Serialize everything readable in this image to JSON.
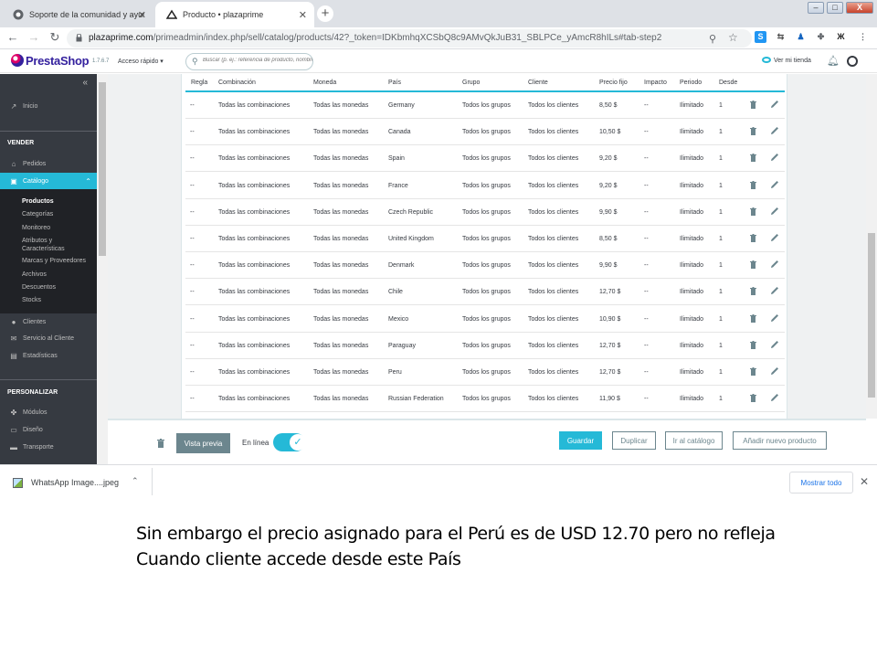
{
  "browser": {
    "tabs": [
      {
        "title": "Soporte de la comunidad y ayuda"
      },
      {
        "title": "Producto • plazaprime"
      }
    ],
    "new_tab": "+",
    "url_host": "plazaprime.com",
    "url_path": "/primeadmin/index.php/sell/catalog/products/42?_token=IDKbmhqXCSbQ8c9AMvQkJuB31_SBLPCe_yAmcR8hILs#tab-step2",
    "window_controls": [
      "–",
      "□",
      "X"
    ]
  },
  "ps_header": {
    "logo": "PrestaShop",
    "version": "1.7.6.7",
    "quick_access": "Acceso rápido ▾",
    "search_placeholder": "Buscar (p. ej.: referencia de producto, nombre de cliente…)",
    "view_store": "Ver mi tienda"
  },
  "sidebar": {
    "collapse": "«",
    "inicio": "Inicio",
    "vender_section": "VENDER",
    "pedidos": "Pedidos",
    "catalogo": "Catálogo",
    "submenu": [
      "Productos",
      "Categorías",
      "Monitoreo",
      "Atributos y Características",
      "Marcas y Proveedores",
      "Archivos",
      "Descuentos",
      "Stocks"
    ],
    "clientes": "Clientes",
    "servicio": "Servicio al Cliente",
    "estadisticas": "Estadísticas",
    "personalizar_section": "PERSONALIZAR",
    "modulos": "Módulos",
    "diseno": "Diseño",
    "transporte": "Transporte"
  },
  "price_table": {
    "headers": [
      "Regla",
      "Combinación",
      "Moneda",
      "País",
      "Grupo",
      "Cliente",
      "Precio fijo",
      "Impacto",
      "Periodo",
      "Desde"
    ],
    "rows": [
      {
        "regla": "--",
        "combinacion": "Todas las combinaciones",
        "moneda": "Todas las monedas",
        "pais": "Germany",
        "grupo": "Todos los grupos",
        "cliente": "Todos los clientes",
        "precio": "8,50 $",
        "impacto": "--",
        "periodo": "Ilimitado",
        "desde": "1"
      },
      {
        "regla": "--",
        "combinacion": "Todas las combinaciones",
        "moneda": "Todas las monedas",
        "pais": "Canada",
        "grupo": "Todos los grupos",
        "cliente": "Todos los clientes",
        "precio": "10,50 $",
        "impacto": "--",
        "periodo": "Ilimitado",
        "desde": "1"
      },
      {
        "regla": "--",
        "combinacion": "Todas las combinaciones",
        "moneda": "Todas las monedas",
        "pais": "Spain",
        "grupo": "Todos los grupos",
        "cliente": "Todos los clientes",
        "precio": "9,20 $",
        "impacto": "--",
        "periodo": "Ilimitado",
        "desde": "1"
      },
      {
        "regla": "--",
        "combinacion": "Todas las combinaciones",
        "moneda": "Todas las monedas",
        "pais": "France",
        "grupo": "Todos los grupos",
        "cliente": "Todos los clientes",
        "precio": "9,20 $",
        "impacto": "--",
        "periodo": "Ilimitado",
        "desde": "1"
      },
      {
        "regla": "--",
        "combinacion": "Todas las combinaciones",
        "moneda": "Todas las monedas",
        "pais": "Czech Republic",
        "grupo": "Todos los grupos",
        "cliente": "Todos los clientes",
        "precio": "9,90 $",
        "impacto": "--",
        "periodo": "Ilimitado",
        "desde": "1"
      },
      {
        "regla": "--",
        "combinacion": "Todas las combinaciones",
        "moneda": "Todas las monedas",
        "pais": "United Kingdom",
        "grupo": "Todos los grupos",
        "cliente": "Todos los clientes",
        "precio": "8,50 $",
        "impacto": "--",
        "periodo": "Ilimitado",
        "desde": "1"
      },
      {
        "regla": "--",
        "combinacion": "Todas las combinaciones",
        "moneda": "Todas las monedas",
        "pais": "Denmark",
        "grupo": "Todos los grupos",
        "cliente": "Todos los clientes",
        "precio": "9,90 $",
        "impacto": "--",
        "periodo": "Ilimitado",
        "desde": "1"
      },
      {
        "regla": "--",
        "combinacion": "Todas las combinaciones",
        "moneda": "Todas las monedas",
        "pais": "Chile",
        "grupo": "Todos los grupos",
        "cliente": "Todos los clientes",
        "precio": "12,70 $",
        "impacto": "--",
        "periodo": "Ilimitado",
        "desde": "1"
      },
      {
        "regla": "--",
        "combinacion": "Todas las combinaciones",
        "moneda": "Todas las monedas",
        "pais": "Mexico",
        "grupo": "Todos los grupos",
        "cliente": "Todos los clientes",
        "precio": "10,90 $",
        "impacto": "--",
        "periodo": "Ilimitado",
        "desde": "1"
      },
      {
        "regla": "--",
        "combinacion": "Todas las combinaciones",
        "moneda": "Todas las monedas",
        "pais": "Paraguay",
        "grupo": "Todos los grupos",
        "cliente": "Todos los clientes",
        "precio": "12,70 $",
        "impacto": "--",
        "periodo": "Ilimitado",
        "desde": "1"
      },
      {
        "regla": "--",
        "combinacion": "Todas las combinaciones",
        "moneda": "Todas las monedas",
        "pais": "Peru",
        "grupo": "Todos los grupos",
        "cliente": "Todos los clientes",
        "precio": "12,70 $",
        "impacto": "--",
        "periodo": "Ilimitado",
        "desde": "1"
      },
      {
        "regla": "--",
        "combinacion": "Todas las combinaciones",
        "moneda": "Todas las monedas",
        "pais": "Russian Federation",
        "grupo": "Todos los grupos",
        "cliente": "Todos los clientes",
        "precio": "11,90 $",
        "impacto": "--",
        "periodo": "Ilimitado",
        "desde": "1"
      }
    ]
  },
  "footer": {
    "preview": "Vista previa",
    "online": "En línea",
    "online_state": true,
    "save": "Guardar",
    "duplicate": "Duplicar",
    "go_catalog": "Ir al catálogo",
    "add_product": "Añadir nuevo producto"
  },
  "downloads": {
    "file": "WhatsApp Image....jpeg",
    "show_all": "Mostrar todo"
  },
  "caption": {
    "line1": "Sin embargo el precio asignado para el Perú es de USD 12.70 pero no refleja",
    "line2": "Cuando cliente accede desde este País"
  },
  "colors": {
    "accent": "#25b9d7",
    "sidebar": "#363a41",
    "brand": "#34219e"
  }
}
